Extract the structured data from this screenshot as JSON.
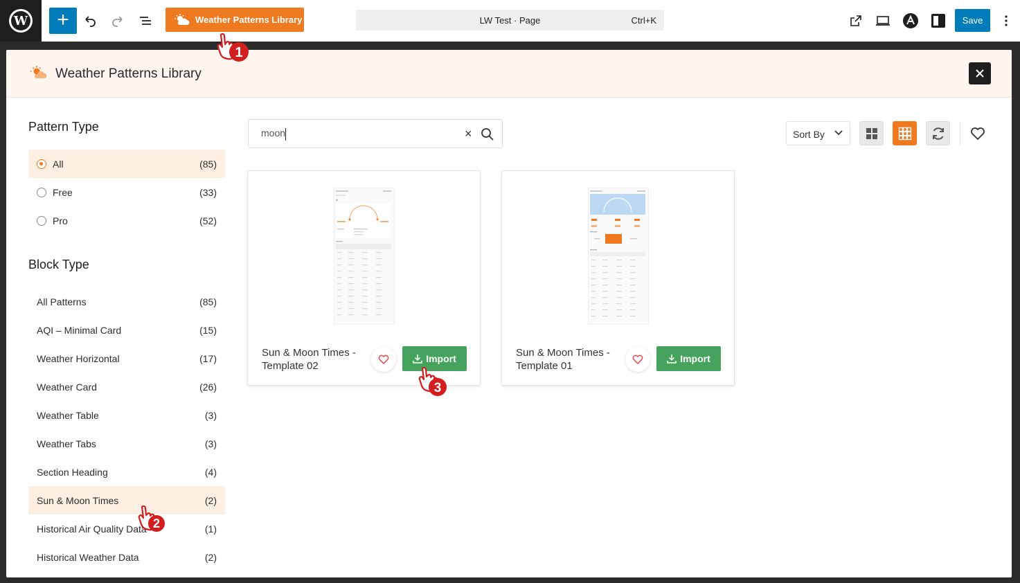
{
  "topbar": {
    "library_button_label": "Weather Patterns Library",
    "document_title": "LW Test · Page",
    "shortcut": "Ctrl+K",
    "save_label": "Save"
  },
  "modal": {
    "title": "Weather Patterns Library"
  },
  "sidebar": {
    "pattern_type_heading": "Pattern Type",
    "pattern_types": [
      {
        "label": "All",
        "count": "(85)"
      },
      {
        "label": "Free",
        "count": "(33)"
      },
      {
        "label": "Pro",
        "count": "(52)"
      }
    ],
    "block_type_heading": "Block Type",
    "block_types": [
      {
        "label": "All Patterns",
        "count": "(85)"
      },
      {
        "label": "AQI – Minimal Card",
        "count": "(15)"
      },
      {
        "label": "Weather Horizontal",
        "count": "(17)"
      },
      {
        "label": "Weather Card",
        "count": "(26)"
      },
      {
        "label": "Weather Table",
        "count": "(3)"
      },
      {
        "label": "Weather Tabs",
        "count": "(3)"
      },
      {
        "label": "Section Heading",
        "count": "(4)"
      },
      {
        "label": "Sun & Moon Times",
        "count": "(2)"
      },
      {
        "label": "Historical Air Quality Data",
        "count": "(1)"
      },
      {
        "label": "Historical Weather Data",
        "count": "(2)"
      }
    ]
  },
  "search": {
    "value": "moon"
  },
  "toolbar": {
    "sort_label": "Sort By"
  },
  "cards": [
    {
      "name": "Sun & Moon Times - Template 02",
      "import_label": "Import"
    },
    {
      "name": "Sun & Moon Times - Template 01",
      "import_label": "Import"
    }
  ],
  "steps": [
    "1",
    "2",
    "3"
  ],
  "colors": {
    "accent": "#f07a20",
    "import": "#46a35e",
    "wp_blue": "#007cba"
  }
}
